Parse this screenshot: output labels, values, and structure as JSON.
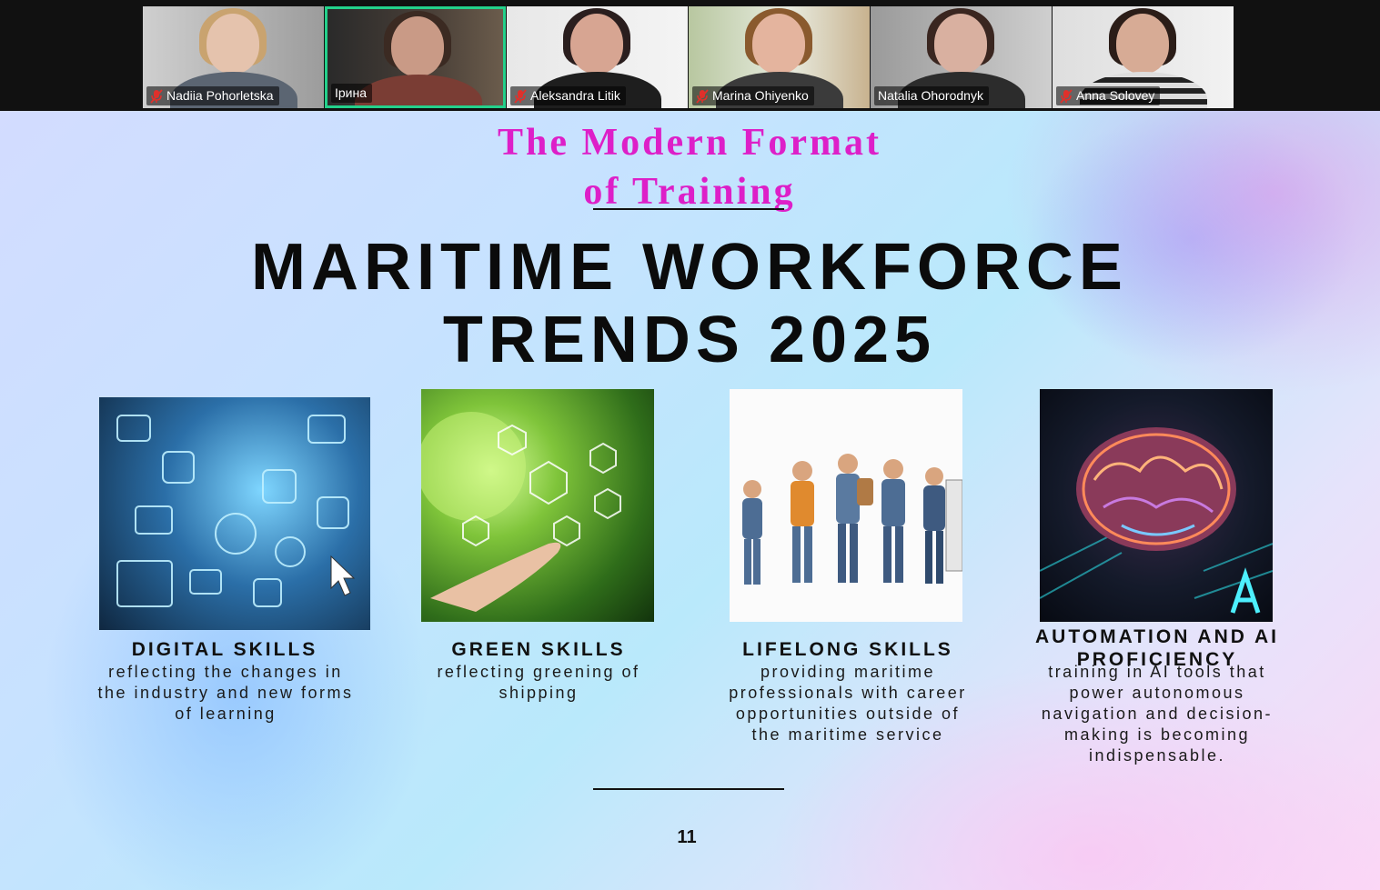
{
  "participants": [
    {
      "name": "Nadiia Pohorletska",
      "muted": true,
      "active": false
    },
    {
      "name": "Ірина",
      "muted": false,
      "active": true
    },
    {
      "name": "Aleksandra Litik",
      "muted": true,
      "active": false
    },
    {
      "name": "Marina Ohiyenko",
      "muted": true,
      "active": false
    },
    {
      "name": "Natalia Ohorodnyk",
      "muted": false,
      "active": false
    },
    {
      "name": "Anna Solovey",
      "muted": true,
      "active": false
    }
  ],
  "slide": {
    "subtitle_line1": "The Modern Format",
    "subtitle_line2": "of Training",
    "title_line1": "MARITIME WORKFORCE",
    "title_line2": "TRENDS 2025",
    "cards": [
      {
        "heading": "DIGITAL SKILLS",
        "description": "reflecting the changes in the industry and new forms of learning"
      },
      {
        "heading": "GREEN SKILLS",
        "description": "reflecting greening of shipping"
      },
      {
        "heading": "LIFELONG SKILLS",
        "description": "providing maritime professionals with career opportunities outside of the maritime service"
      },
      {
        "heading": "AUTOMATION AND AI PROFICIENCY",
        "description": "training in AI tools that power autonomous navigation and decision-making is becoming indispensable."
      }
    ],
    "page_number": "11"
  },
  "colors": {
    "subtitle": "#dd1fc8",
    "active_speaker_border": "#23d18b",
    "mute_icon": "#e0302b"
  }
}
